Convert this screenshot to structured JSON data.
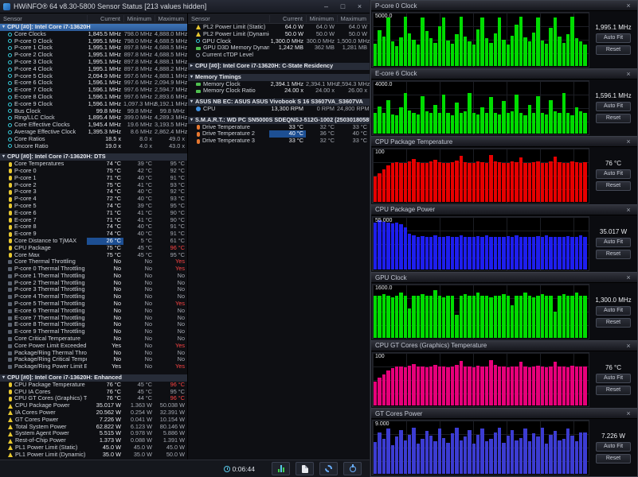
{
  "window": {
    "title": "HWiNFO® 64 v8.30-5800 Sensor Status [213 values hidden]",
    "controls": {
      "minimize": "–",
      "maximize": "□",
      "close": "×"
    },
    "columns": [
      "Sensor",
      "Current",
      "Minimum",
      "Maximum"
    ],
    "toolbar": {
      "time": "0:06:44"
    }
  },
  "left_table": {
    "sections": [
      {
        "header": "CPU [#0]: Intel Core i7-13620H",
        "selected": true,
        "rows": [
          {
            "ic": "clock",
            "l": "Core Clocks",
            "c": "1,845.5 MHz",
            "m": "798.0 MHz",
            "x": "4,888.0 MHz"
          },
          {
            "ic": "clock",
            "l": "P-core 0 Clock",
            "c": "1,995.1 MHz",
            "m": "798.0 MHz",
            "x": "4,688.5 MHz"
          },
          {
            "ic": "clock",
            "l": "P-core 1 Clock",
            "c": "1,995.1 MHz",
            "m": "897.8 MHz",
            "x": "4,688.5 MHz"
          },
          {
            "ic": "clock",
            "l": "P-core 2 Clock",
            "c": "1,995.1 MHz",
            "m": "897.8 MHz",
            "x": "4,688.5 MHz"
          },
          {
            "ic": "clock",
            "l": "P-core 3 Clock",
            "c": "1,995.1 MHz",
            "m": "897.8 MHz",
            "x": "4,888.1 MHz"
          },
          {
            "ic": "clock",
            "l": "P-core 4 Clock",
            "c": "1,995.1 MHz",
            "m": "897.8 MHz",
            "x": "4,888.2 MHz"
          },
          {
            "ic": "clock",
            "l": "P-core 5 Clock",
            "c": "2,094.9 MHz",
            "m": "997.6 MHz",
            "x": "4,888.1 MHz"
          },
          {
            "ic": "clock",
            "l": "E-core 6 Clock",
            "c": "1,596.1 MHz",
            "m": "997.6 MHz",
            "x": "2,094.9 MHz"
          },
          {
            "ic": "clock",
            "l": "E-core 7 Clock",
            "c": "1,596.1 MHz",
            "m": "997.6 MHz",
            "x": "2,594.7 MHz"
          },
          {
            "ic": "clock",
            "l": "E-core 8 Clock",
            "c": "1,596.1 MHz",
            "m": "997.6 MHz",
            "x": "2,893.6 MHz"
          },
          {
            "ic": "clock",
            "l": "E-core 9 Clock",
            "c": "1,596.1 MHz",
            "m": "1,097.3 MHz",
            "x": "3,192.1 MHz"
          },
          {
            "ic": "clock",
            "l": "Bus Clock",
            "c": "99.8 MHz",
            "m": "99.8 MHz",
            "x": "99.8 MHz"
          },
          {
            "ic": "clock",
            "l": "Ring/LLC Clock",
            "c": "1,895.4 MHz",
            "m": "399.0 MHz",
            "x": "4,289.3 MHz"
          },
          {
            "ic": "clock",
            "l": "Core Effective Clocks",
            "c": "1,945.4 MHz",
            "m": "19.6 MHz",
            "x": "3,193.5 MHz"
          },
          {
            "ic": "clock",
            "l": "Average Effective Clock",
            "c": "1,395.3 MHz",
            "m": "8.6 MHz",
            "x": "2,862.4 MHz"
          },
          {
            "ic": "clock",
            "l": "Core Ratios",
            "c": "18.5 x",
            "m": "8.0 x",
            "x": "49.0 x"
          },
          {
            "ic": "clock",
            "l": "Uncore Ratio",
            "c": "19.0 x",
            "m": "4.0 x",
            "x": "43.0 x"
          }
        ]
      },
      {
        "header": "CPU [#0]: Intel Core i7-13620H: DTS",
        "rows": [
          {
            "ic": "temp",
            "l": "Core Temperatures",
            "c": "74 °C",
            "m": "39 °C",
            "x": "95 °C"
          },
          {
            "ic": "temp",
            "l": "P-core 0",
            "c": "75 °C",
            "m": "42 °C",
            "x": "92 °C"
          },
          {
            "ic": "temp",
            "l": "P-core 1",
            "c": "71 °C",
            "m": "40 °C",
            "x": "91 °C"
          },
          {
            "ic": "temp",
            "l": "P-core 2",
            "c": "75 °C",
            "m": "41 °C",
            "x": "93 °C"
          },
          {
            "ic": "temp",
            "l": "P-core 3",
            "c": "74 °C",
            "m": "40 °C",
            "x": "92 °C"
          },
          {
            "ic": "temp",
            "l": "P-core 4",
            "c": "72 °C",
            "m": "40 °C",
            "x": "93 °C"
          },
          {
            "ic": "temp",
            "l": "P-core 5",
            "c": "74 °C",
            "m": "39 °C",
            "x": "95 °C"
          },
          {
            "ic": "temp",
            "l": "E-core 6",
            "c": "71 °C",
            "m": "41 °C",
            "x": "90 °C"
          },
          {
            "ic": "temp",
            "l": "E-core 7",
            "c": "71 °C",
            "m": "41 °C",
            "x": "90 °C"
          },
          {
            "ic": "temp",
            "l": "E-core 8",
            "c": "74 °C",
            "m": "40 °C",
            "x": "91 °C"
          },
          {
            "ic": "temp",
            "l": "E-core 9",
            "c": "74 °C",
            "m": "40 °C",
            "x": "91 °C"
          },
          {
            "ic": "temp",
            "l": "Core Distance to TjMAX",
            "c": "26 °C",
            "m": "5 °C",
            "x": "61 °C",
            "hl": true
          },
          {
            "ic": "temp",
            "l": "CPU Package",
            "c": "75 °C",
            "m": "45 °C",
            "x": "96 °C",
            "xr": true
          },
          {
            "ic": "temp",
            "l": "Core Max",
            "c": "75 °C",
            "m": "45 °C",
            "x": "95 °C"
          },
          {
            "ic": "flag",
            "l": "Core Thermal Throttling",
            "c": "No",
            "m": "No",
            "x": "Yes",
            "xr": true
          },
          {
            "ic": "flag",
            "l": "P-core 0 Thermal Throttling",
            "c": "No",
            "m": "No",
            "x": "Yes",
            "xr": true
          },
          {
            "ic": "flag",
            "l": "P-core 1 Thermal Throttling",
            "c": "No",
            "m": "No",
            "x": "No"
          },
          {
            "ic": "flag",
            "l": "P-core 2 Thermal Throttling",
            "c": "No",
            "m": "No",
            "x": "No"
          },
          {
            "ic": "flag",
            "l": "P-core 3 Thermal Throttling",
            "c": "No",
            "m": "No",
            "x": "No"
          },
          {
            "ic": "flag",
            "l": "P-core 4 Thermal Throttling",
            "c": "No",
            "m": "No",
            "x": "No"
          },
          {
            "ic": "flag",
            "l": "P-core 5 Thermal Throttling",
            "c": "No",
            "m": "No",
            "x": "Yes",
            "xr": true
          },
          {
            "ic": "flag",
            "l": "E-core 6 Thermal Throttling",
            "c": "No",
            "m": "No",
            "x": "No"
          },
          {
            "ic": "flag",
            "l": "E-core 7 Thermal Throttling",
            "c": "No",
            "m": "No",
            "x": "No"
          },
          {
            "ic": "flag",
            "l": "E-core 8 Thermal Throttling",
            "c": "No",
            "m": "No",
            "x": "No"
          },
          {
            "ic": "flag",
            "l": "E-core 9 Thermal Throttling",
            "c": "No",
            "m": "No",
            "x": "No"
          },
          {
            "ic": "flag",
            "l": "Core Critical Temperature",
            "c": "No",
            "m": "No",
            "x": "No"
          },
          {
            "ic": "flag",
            "l": "Core Power Limit Exceeded",
            "c": "Yes",
            "m": "No",
            "x": "Yes",
            "xr": true
          },
          {
            "ic": "flag",
            "l": "Package/Ring Thermal Throttling",
            "c": "No",
            "m": "No",
            "x": "No"
          },
          {
            "ic": "flag",
            "l": "Package/Ring Critical Temperature",
            "c": "No",
            "m": "No",
            "x": "No"
          },
          {
            "ic": "flag",
            "l": "Package/Ring Power Limit Exce...",
            "c": "Yes",
            "m": "No",
            "x": "Yes",
            "xr": true
          }
        ]
      },
      {
        "header": "CPU [#0]: Intel Core i7-13620H: Enhanced",
        "rows": [
          {
            "ic": "temp",
            "l": "CPU Package Temperature",
            "c": "76 °C",
            "m": "45 °C",
            "x": "96 °C",
            "xr": true
          },
          {
            "ic": "temp",
            "l": "CPU IA Cores",
            "c": "76 °C",
            "m": "45 °C",
            "x": "95 °C"
          },
          {
            "ic": "temp",
            "l": "CPU GT Cores (Graphics) Temper...",
            "c": "76 °C",
            "m": "44 °C",
            "x": "96 °C",
            "xr": true
          },
          {
            "ic": "power",
            "l": "CPU Package Power",
            "c": "35.017 W",
            "m": "1.363 W",
            "x": "50.038 W"
          },
          {
            "ic": "power",
            "l": "IA Cores Power",
            "c": "20.562 W",
            "m": "0.254 W",
            "x": "32.391 W"
          },
          {
            "ic": "power",
            "l": "GT Cores Power",
            "c": "7.226 W",
            "m": "0.041 W",
            "x": "10.154 W"
          },
          {
            "ic": "power",
            "l": "Total System Power",
            "c": "62.822 W",
            "m": "6.123 W",
            "x": "80.146 W"
          },
          {
            "ic": "power",
            "l": "System Agent Power",
            "c": "5.515 W",
            "m": "0.978 W",
            "x": "5.886 W"
          },
          {
            "ic": "power",
            "l": "Rest-of-Chip Power",
            "c": "1.373 W",
            "m": "0.088 W",
            "x": "1.391 W"
          },
          {
            "ic": "power",
            "l": "PL1 Power Limit (Static)",
            "c": "45.0 W",
            "m": "45.0 W",
            "x": "45.0 W"
          },
          {
            "ic": "power",
            "l": "PL1 Power Limit (Dynamic)",
            "c": "35.0 W",
            "m": "35.0 W",
            "x": "50.0 W"
          }
        ]
      }
    ]
  },
  "right_table": {
    "sections": [
      {
        "header": null,
        "rows": [
          {
            "ic": "power",
            "l": "PL2 Power Limit (Static)",
            "c": "64.0 W",
            "m": "64.0 W",
            "x": "64.0 W"
          },
          {
            "ic": "power",
            "l": "PL2 Power Limit (Dynamic)",
            "c": "50.0 W",
            "m": "50.0 W",
            "x": "50.0 W"
          },
          {
            "ic": "clock",
            "l": "GPU Clock",
            "c": "1,300.0 MHz",
            "m": "300.0 MHz",
            "x": "1,500.0 MHz"
          },
          {
            "ic": "mem",
            "l": "GPU D3D Memory Dynamic",
            "c": "1,242 MB",
            "m": "362 MB",
            "x": "1,281 MB"
          },
          {
            "ic": "level",
            "l": "Current cTDP Level",
            "c": "",
            "m": "",
            "x": ""
          }
        ]
      },
      {
        "header": "CPU [#0]: Intel Core i7-13620H: C-State Residency",
        "collapsed": true,
        "rows": []
      },
      {
        "header": "Memory Timings",
        "rows": [
          {
            "ic": "mem",
            "l": "Memory Clock",
            "c": "2,394.1 MHz",
            "m": "2,394.1 MHz",
            "x": "2,594.3 MHz"
          },
          {
            "ic": "mem",
            "l": "Memory Clock Ratio",
            "c": "24.00 x",
            "m": "24.00 x",
            "x": "26.00 x"
          }
        ]
      },
      {
        "header": "ASUS NB EC: ASUS ASUS Vivobook S 16 S3607VA_S3607VA",
        "rows": [
          {
            "ic": "fan",
            "l": "CPU",
            "c": "13,300 RPM",
            "m": "0 RPM",
            "x": "24,800 RPM"
          }
        ]
      },
      {
        "header": "S.M.A.R.T.: WD PC SN5000S SDEQNSJ-512G-1002 (250301805850)",
        "rows": [
          {
            "ic": "dtemp",
            "l": "Drive Temperature",
            "c": "33 °C",
            "m": "32 °C",
            "x": "33 °C"
          },
          {
            "ic": "dtemp",
            "l": "Drive Temperature 2",
            "c": "40 °C",
            "m": "36 °C",
            "x": "40 °C",
            "hl": true
          },
          {
            "ic": "dtemp",
            "l": "Drive Temperature 3",
            "c": "33 °C",
            "m": "32 °C",
            "x": "33 °C"
          }
        ]
      }
    ]
  },
  "graph_buttons": {
    "auto_fit": "Auto Fit",
    "reset": "Reset"
  },
  "graphs": [
    {
      "type": "bar",
      "title": "P-core 0 Clock",
      "scale": "5000.0",
      "value": "1,995.1 MHz",
      "color": "#00dc00",
      "ymax": 5000,
      "values": [
        2100,
        3400,
        2800,
        4650,
        2300,
        1900,
        2700,
        4700,
        3100,
        2500,
        2000,
        4600,
        3300,
        2600,
        2200,
        3800,
        4650,
        2400,
        2100,
        3000,
        4700,
        2800,
        2300,
        1995,
        3500,
        4600,
        2600,
        2200,
        3100,
        4650,
        2500,
        2000,
        2900,
        3900,
        4700,
        2700,
        2300,
        3200,
        4600,
        2400,
        2100,
        3600,
        4650,
        2800,
        2200,
        3000,
        4700,
        2600,
        2300,
        1995
      ]
    },
    {
      "type": "bar",
      "title": "E-core 6 Clock",
      "scale": "4000.0",
      "value": "1,596.1 MHz",
      "color": "#00dc00",
      "ymax": 4000,
      "values": [
        1600,
        2100,
        1600,
        2600,
        1500,
        1400,
        2000,
        3100,
        1800,
        1600,
        1500,
        2900,
        1700,
        1600,
        2200,
        1600,
        3000,
        1600,
        1400,
        2400,
        1600,
        1700,
        3100,
        1600,
        1500,
        2000,
        1600,
        2800,
        1600,
        1500,
        2500,
        1600,
        1700,
        3000,
        1600,
        1400,
        2200,
        1600,
        2900,
        1600,
        1500,
        2600,
        1700,
        1600,
        3100,
        1600,
        1400,
        2000,
        1700,
        1596
      ]
    },
    {
      "type": "bar",
      "title": "CPU Package Temperature",
      "scale": "100",
      "value": "76 °C",
      "color": "#e60000",
      "ymax": 100,
      "values": [
        48,
        55,
        62,
        70,
        74,
        76,
        75,
        74,
        78,
        82,
        76,
        75,
        74,
        77,
        80,
        76,
        75,
        74,
        76,
        79,
        88,
        76,
        75,
        74,
        77,
        76,
        75,
        90,
        78,
        76,
        75,
        74,
        77,
        76,
        85,
        75,
        74,
        76,
        78,
        75,
        74,
        77,
        86,
        76,
        75,
        74,
        78,
        76,
        75,
        76
      ]
    },
    {
      "type": "bar",
      "title": "CPU Package Power",
      "scale": "55.000",
      "value": "35.017 W",
      "color": "#1e1eee",
      "ymax": 55,
      "values": [
        50,
        52,
        51,
        50,
        49,
        50,
        48,
        45,
        38,
        36,
        35,
        35.5,
        35,
        35,
        36,
        35,
        35,
        35.5,
        35,
        35,
        36,
        35,
        35,
        35,
        35.5,
        35,
        36,
        35,
        35,
        35,
        35,
        35.5,
        35,
        36,
        35,
        35,
        35,
        35,
        35.5,
        35,
        36,
        35,
        35,
        35,
        35,
        35.5,
        35,
        35,
        36,
        35
      ]
    },
    {
      "type": "bar",
      "title": "GPU Clock",
      "scale": "1600.0",
      "value": "1,300.0 MHz",
      "color": "#00dc00",
      "ymax": 1600,
      "values": [
        1300,
        1300,
        1350,
        1300,
        1250,
        1300,
        1400,
        1300,
        900,
        1300,
        1300,
        1350,
        1300,
        1300,
        1450,
        1300,
        1250,
        1300,
        1300,
        700,
        1300,
        1350,
        1300,
        1300,
        1400,
        1300,
        1300,
        1250,
        1300,
        1300,
        1350,
        1300,
        1000,
        1300,
        1300,
        1400,
        1300,
        1250,
        1300,
        1350,
        1300,
        1300,
        800,
        1300,
        1350,
        1300,
        1300,
        1400,
        1300,
        1300
      ]
    },
    {
      "type": "bar",
      "title": "CPU GT Cores (Graphics) Temperature",
      "scale": "100",
      "value": "76 °C",
      "color": "#e6007a",
      "ymax": 100,
      "values": [
        46,
        54,
        60,
        68,
        73,
        75,
        76,
        74,
        77,
        80,
        76,
        75,
        74,
        76,
        79,
        76,
        75,
        74,
        76,
        78,
        86,
        76,
        75,
        74,
        77,
        76,
        75,
        88,
        78,
        76,
        75,
        74,
        76,
        75,
        84,
        76,
        74,
        76,
        77,
        75,
        74,
        76,
        85,
        76,
        75,
        74,
        77,
        76,
        75,
        76
      ]
    },
    {
      "type": "bar",
      "title": "GT Cores Power",
      "scale": "9.000",
      "value": "7.226 W",
      "color": "#3c3cd2",
      "ymax": 9,
      "values": [
        5.5,
        7.2,
        6,
        7.8,
        5,
        6.5,
        7.5,
        5.8,
        6.8,
        7.9,
        5.2,
        6,
        7.4,
        6.6,
        5.6,
        7.8,
        6.2,
        5.4,
        7,
        7.9,
        5.8,
        6.4,
        7.6,
        5.2,
        6.8,
        7.8,
        5.6,
        6,
        7.2,
        7.9,
        5.4,
        6.6,
        7.5,
        5.8,
        6.2,
        7.8,
        5.6,
        7,
        6.4,
        7.9,
        5.2,
        6.8,
        7.4,
        5.8,
        6,
        7.8,
        6.6,
        5.6,
        7.2,
        7.2
      ]
    }
  ]
}
